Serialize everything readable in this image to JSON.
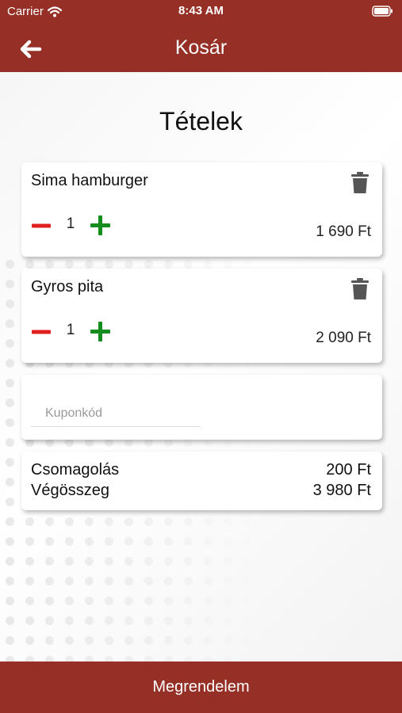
{
  "status_bar": {
    "carrier": "Carrier",
    "time": "8:43 AM"
  },
  "header": {
    "title": "Kosár"
  },
  "page": {
    "title": "Tételek"
  },
  "items": [
    {
      "name": "Sima hamburger",
      "quantity": "1",
      "price": "1 690 Ft"
    },
    {
      "name": "Gyros pita",
      "quantity": "1",
      "price": "2 090 Ft"
    }
  ],
  "coupon": {
    "placeholder": "Kuponkód",
    "value": ""
  },
  "summary": {
    "packaging_label": "Csomagolás",
    "packaging_value": "200 Ft",
    "total_label": "Végösszeg",
    "total_value": "3 980 Ft"
  },
  "footer": {
    "order_label": "Megrendelem"
  },
  "colors": {
    "brand": "#962f25",
    "minus": "#e0201e",
    "plus": "#148c1e",
    "trash": "#555555"
  },
  "icons": [
    "wifi-icon",
    "battery-icon",
    "back-arrow-icon",
    "trash-icon",
    "minus-icon",
    "plus-icon"
  ]
}
